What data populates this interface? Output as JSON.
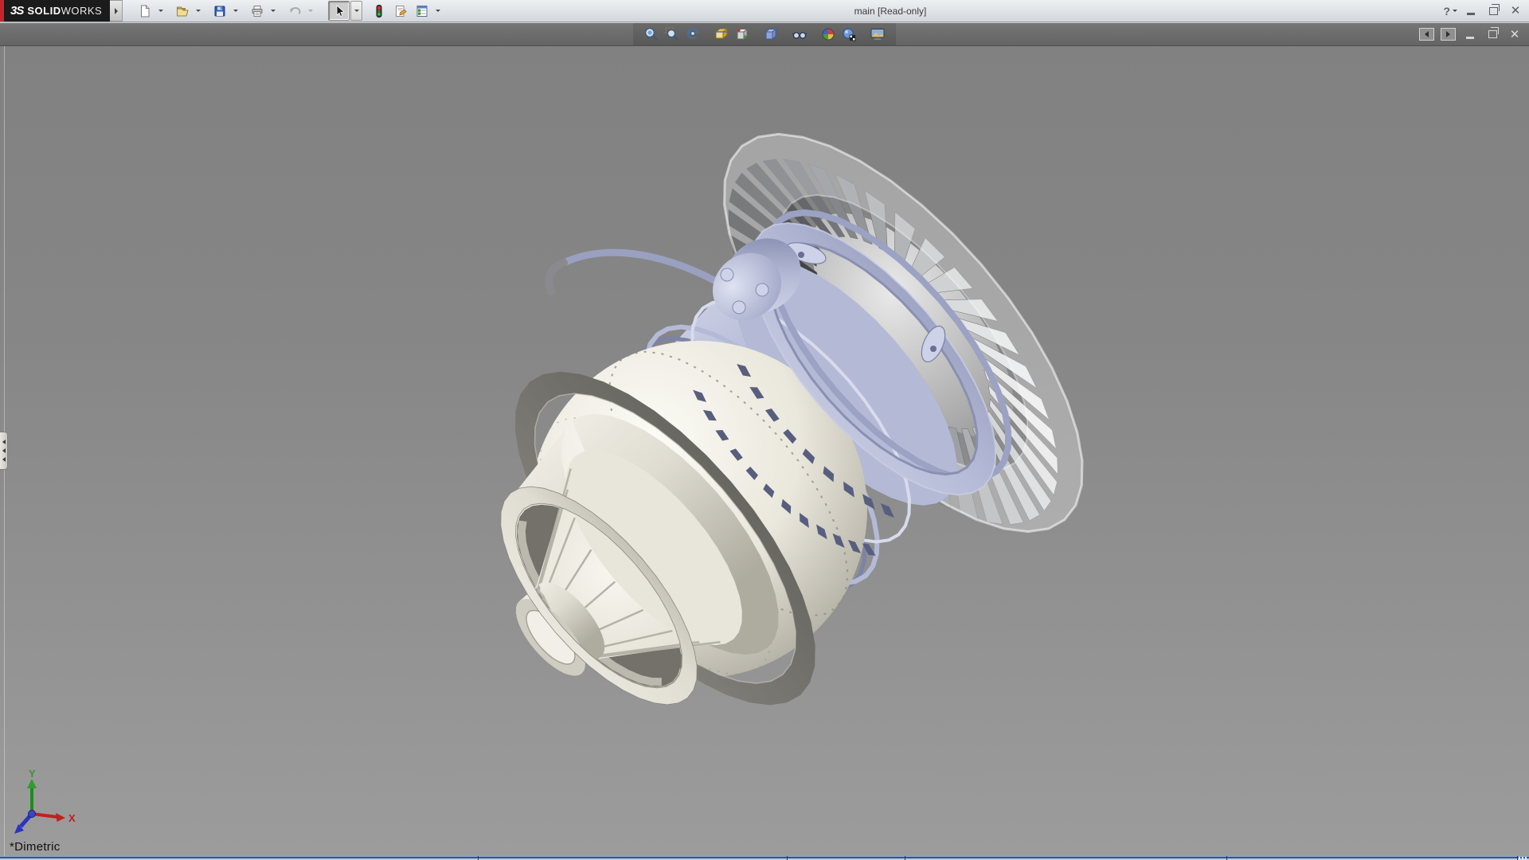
{
  "app": {
    "brand": {
      "accent_color": "#c8242b",
      "logo_glyph": "3S",
      "name_bold": "SOLID",
      "name_light": "WORKS"
    },
    "title": "main [Read-only]"
  },
  "main_toolbar": {
    "buttons": [
      {
        "name": "new-document",
        "has_caret": true
      },
      {
        "name": "open",
        "has_caret": true
      },
      {
        "name": "save",
        "has_caret": true
      },
      {
        "name": "print",
        "has_caret": true
      },
      {
        "name": "undo",
        "has_caret": true,
        "disabled": true
      },
      {
        "name": "select",
        "has_caret": true,
        "pressed": true
      },
      {
        "name": "rebuild",
        "has_caret": false
      },
      {
        "name": "file-properties",
        "has_caret": false
      },
      {
        "name": "options",
        "has_caret": true
      }
    ]
  },
  "window_controls": {
    "help_glyph": "?",
    "app_buttons": [
      "help",
      "minimize",
      "restore",
      "close"
    ],
    "document_buttons": [
      "collapse-left-pane",
      "collapse-right-pane",
      "minimize-document",
      "restore-document",
      "close-document"
    ]
  },
  "headsup_toolbar": {
    "items": [
      "zoom-to-fit",
      "zoom-to-area",
      "previous-view",
      "section-view",
      "view-orientation",
      "display-style",
      "hide-show-items",
      "edit-appearance",
      "apply-scene",
      "view-settings"
    ]
  },
  "viewport": {
    "orientation_label": "*Dimetric",
    "background_top": "#818181",
    "background_bottom": "#9c9c9c",
    "triad": {
      "x_label": "X",
      "y_label": "Y",
      "x_color": "#c41f1f",
      "y_color": "#2e9e2e",
      "z_color": "#2a35c0"
    }
  },
  "model": {
    "description": "jet-engine-turbofan-assembly",
    "colors": {
      "cream_light": "#f6f4ed",
      "cream_mid": "#dfdcd1",
      "cream_dark": "#aeab9f",
      "interior_shadow": "#73716a",
      "interior_light": "#d3d0c5",
      "gray_ring_dark": "#55534e",
      "gray_ring_light": "#9b9992",
      "lavender_light": "#d8dbec",
      "lavender_mid": "#b4bad6",
      "lavender_dark": "#7d83a6",
      "slot_dark": "#585e7e",
      "blade_hue": 222,
      "shroud": "#ffffff",
      "hub_light": "#e9e9e9",
      "hub_dark": "#9c9c9c"
    }
  }
}
